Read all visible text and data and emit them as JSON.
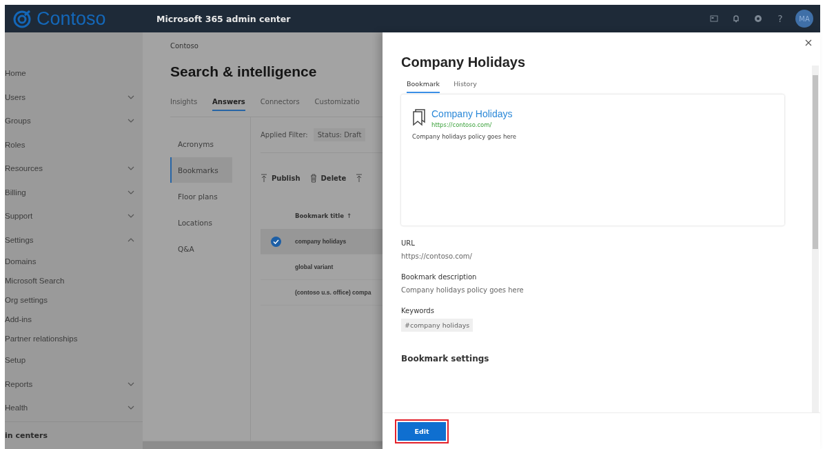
{
  "header": {
    "logo": "Contoso",
    "title": "Microsoft 365 admin center",
    "help": "?",
    "avatar": "MA"
  },
  "nav": {
    "items": [
      {
        "label": "Home"
      },
      {
        "label": "Users",
        "expanded": false
      },
      {
        "label": "Groups",
        "expanded": false
      },
      {
        "label": "Roles"
      },
      {
        "label": "Resources",
        "expanded": false
      },
      {
        "label": "Billing",
        "expanded": false
      },
      {
        "label": "Support",
        "expanded": false
      },
      {
        "label": "Settings",
        "expanded": true,
        "children": [
          {
            "label": "Domains"
          },
          {
            "label": "Microsoft Search"
          },
          {
            "label": "Org settings"
          },
          {
            "label": "Add-ins"
          },
          {
            "label": "Partner relationships"
          }
        ]
      },
      {
        "label": "Setup"
      },
      {
        "label": "Reports",
        "expanded": false
      },
      {
        "label": "Health",
        "expanded": false
      }
    ],
    "footer": "in centers"
  },
  "page": {
    "breadcrumb": "Contoso",
    "title": "Search & intelligence",
    "tabs": [
      {
        "label": "Insights",
        "selected": false
      },
      {
        "label": "Answers",
        "selected": true
      },
      {
        "label": "Connectors",
        "selected": false
      },
      {
        "label": "Customizatio",
        "selected": false
      }
    ],
    "subnav": [
      {
        "label": "Acronyms",
        "selected": false
      },
      {
        "label": "Bookmarks",
        "selected": true
      },
      {
        "label": "Floor plans",
        "selected": false
      },
      {
        "label": "Locations",
        "selected": false
      },
      {
        "label": "Q&A",
        "selected": false
      }
    ],
    "filter": {
      "label": "Applied Filter:",
      "value": "Status: Draft"
    },
    "toolbar": [
      {
        "kind": "publish",
        "label": "Publish"
      },
      {
        "kind": "delete",
        "label": "Delete"
      },
      {
        "kind": "publish"
      }
    ],
    "table": {
      "column": {
        "label": "Bookmark title",
        "sort_arrow": "↑"
      },
      "rows": [
        {
          "title": "company holidays",
          "selected": true
        },
        {
          "title": "global variant",
          "selected": false
        },
        {
          "title": "(contoso u.s. office) compa",
          "selected": false
        }
      ]
    }
  },
  "panel": {
    "title": "Company Holidays",
    "tabs": [
      {
        "label": "Bookmark",
        "selected": true
      },
      {
        "label": "History",
        "selected": false
      }
    ],
    "card": {
      "title": "Company Holidays",
      "url": "https://contoso.com/",
      "description": "Company holidays policy goes here"
    },
    "fields": [
      {
        "kind": "text",
        "label": "URL",
        "value": "https://contoso.com/"
      },
      {
        "kind": "text",
        "label": "Bookmark description",
        "value": "Company holidays policy goes here"
      },
      {
        "kind": "chip",
        "label": "Keywords",
        "value": "#company holidays"
      }
    ],
    "section": "Bookmark settings",
    "primary_button": {
      "label": "Edit",
      "highlighted": true
    }
  }
}
